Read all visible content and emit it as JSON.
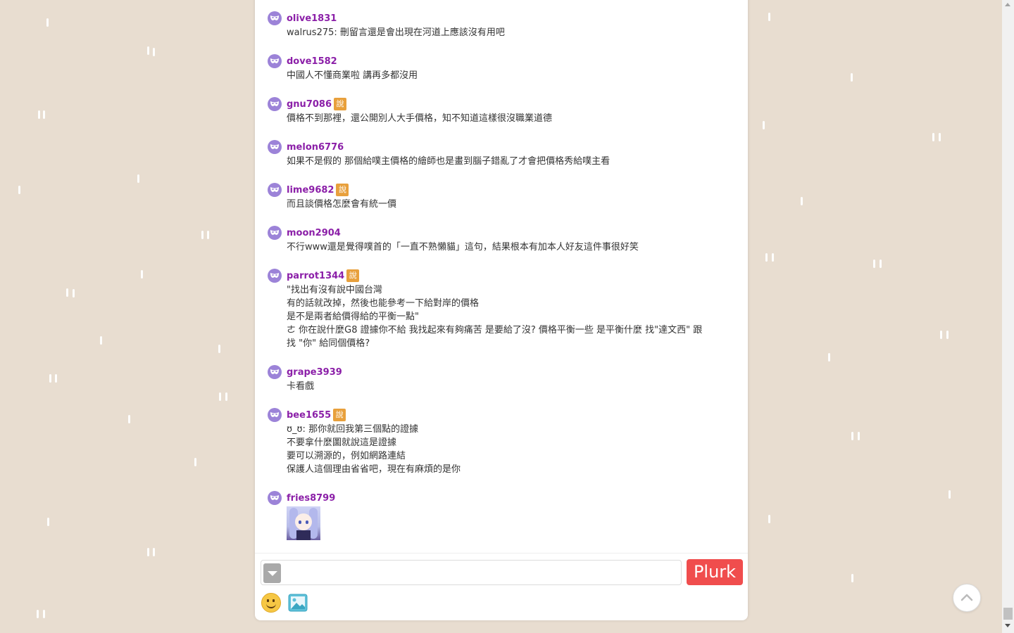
{
  "theme": {
    "background": "#e8ddd0",
    "username_color": "#8b1fa8",
    "qualifier_color": "#e8a03c",
    "plurk_button_color": "#f04d4d",
    "avatar_mask_color": "#9c83d8"
  },
  "responses": [
    {
      "username": "olive1831",
      "qualifier": "",
      "lines": [
        "walrus275: 刪留言還是會出現在河道上應該沒有用吧"
      ]
    },
    {
      "username": "dove1582",
      "qualifier": "",
      "lines": [
        "中國人不懂商業啦 講再多都沒用"
      ]
    },
    {
      "username": "gnu7086",
      "qualifier": "說",
      "lines": [
        "價格不到那裡，還公開別人大手價格，知不知道這樣很沒職業道德"
      ]
    },
    {
      "username": "melon6776",
      "qualifier": "",
      "lines": [
        "如果不是假的 那個給噗主價格的繪師也是畫到腦子錯亂了才會把價格秀給噗主看"
      ]
    },
    {
      "username": "lime9682",
      "qualifier": "說",
      "lines": [
        "而且談價格怎麼會有統一價"
      ]
    },
    {
      "username": "moon2904",
      "qualifier": "",
      "lines": [
        "不行www還是覺得噗首的「一直不熟懶貓」這句，結果根本有加本人好友這件事很好笑"
      ]
    },
    {
      "username": "parrot1344",
      "qualifier": "說",
      "lines": [
        "\"找出有沒有說中國台灣",
        "有的話就改掉，然後也能參考一下給對岸的價格",
        "是不是兩者給價得給的平衡一點\"",
        "ㄜ 你在說什麼G8 證據你不給 我找起來有夠痛苦 是要給了沒? 價格平衡一些 是平衡什麼 找\"達文西\" 跟",
        "找 \"你\" 給同個價格?"
      ]
    },
    {
      "username": "grape3939",
      "qualifier": "",
      "lines": [
        "卡看戲"
      ]
    },
    {
      "username": "bee1655",
      "qualifier": "說",
      "lines": [
        "ʊ_ʊ: 那你就回我第三個點的證據",
        "不要拿什麼圖就說這是證據",
        "要可以溯源的，例如網路連結",
        "保護人這個理由省省吧，現在有麻煩的是你"
      ]
    },
    {
      "username": "fries8799",
      "qualifier": "",
      "lines": [],
      "has_image": true
    }
  ],
  "composer": {
    "placeholder": "",
    "submit_label": "Plurk"
  }
}
